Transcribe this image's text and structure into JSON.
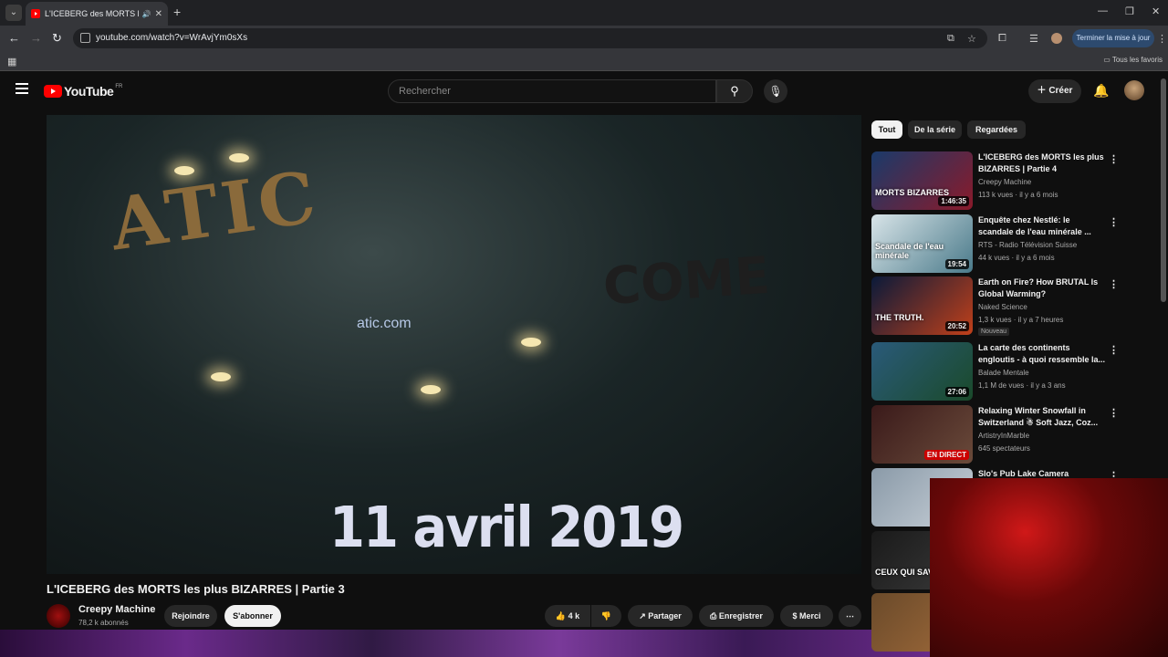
{
  "browser": {
    "tab_title": "L'ICEBERG des MORTS les p",
    "url": "youtube.com/watch?v=WrAvjYm0sXs",
    "update_button": "Terminer la mise à jour",
    "bookmarks_all": "Tous les favoris"
  },
  "header": {
    "logo_text": "YouTube",
    "country_code": "FR",
    "search_placeholder": "Rechercher",
    "create_label": "Créer"
  },
  "video": {
    "sign_text": "ATIC",
    "sign_text2": "COME",
    "url_on_sign": "atic.com",
    "caption": "11 avril 2019",
    "title": "L'ICEBERG des MORTS les plus BIZARRES | Partie 3",
    "channel": "Creepy Machine",
    "subscribers": "78,2 k abonnés",
    "join_label": "Rejoindre",
    "subscribe_label": "S'abonner",
    "likes": "4 k",
    "share_label": "Partager",
    "save_label": "Enregistrer",
    "thanks_label": "Merci"
  },
  "chips": [
    "Tout",
    "De la série",
    "Regardées"
  ],
  "recommendations": [
    {
      "title": "L'ICEBERG des MORTS les plus BIZARRES | Partie 4",
      "channel": "Creepy Machine",
      "meta": "113 k vues · il y a 6 mois",
      "duration": "1:46:35",
      "thumb_text": "MORTS BIZARRES",
      "colors": [
        "#1a3a6a",
        "#8a1a2a"
      ]
    },
    {
      "title": "Enquête chez Nestlé: le scandale de l'eau minérale ...",
      "channel": "RTS - Radio Télévision Suisse",
      "meta": "44 k vues · il y a 6 mois",
      "duration": "19:54",
      "thumb_text": "Scandale de l'eau minérale",
      "colors": [
        "#d8e4e8",
        "#4a7a8a"
      ]
    },
    {
      "title": "Earth on Fire? How BRUTAL Is Global Warming?",
      "channel": "Naked Science",
      "meta": "1,3 k vues · il y a 7 heures",
      "duration": "20:52",
      "badge": "Nouveau",
      "thumb_text": "THE TRUTH.",
      "colors": [
        "#0a1a3a",
        "#c0401a"
      ]
    },
    {
      "title": "La carte des continents engloutis - à quoi ressemble la...",
      "channel": "Balade Mentale",
      "meta": "1,1 M de vues · il y a 3 ans",
      "duration": "27:06",
      "thumb_text": "",
      "colors": [
        "#2a5a7a",
        "#1a4a2a"
      ]
    },
    {
      "title": "Relaxing Winter Snowfall in Switzerland ☃ Soft Jazz, Coz...",
      "channel": "ArtistryInMarble",
      "meta": "645 spectateurs",
      "live": "EN DIRECT",
      "thumb_text": "",
      "colors": [
        "#3a1a1a",
        "#6a4a3a"
      ]
    },
    {
      "title": "Slo's Pub Lake Camera",
      "channel": "",
      "meta": "",
      "thumb_text": "",
      "colors": [
        "#8a9aa8",
        "#c8d0d8"
      ]
    },
    {
      "title": "",
      "channel": "",
      "meta": "",
      "thumb_text": "CEUX QUI SAVENT...",
      "colors": [
        "#1a1a1a",
        "#3a3a3a"
      ]
    },
    {
      "title": "",
      "channel": "",
      "meta": "",
      "thumb_text": "",
      "colors": [
        "#6a4a2a",
        "#a06a3a"
      ]
    }
  ]
}
